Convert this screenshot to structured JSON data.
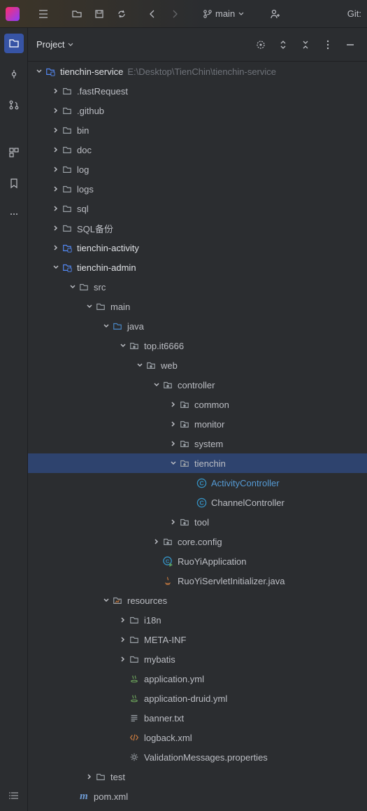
{
  "toolbar": {
    "branch": "main",
    "git_label": "Git:"
  },
  "panel": {
    "title": "Project"
  },
  "root": {
    "name": "tienchin-service",
    "path": "E:\\Desktop\\TienChin\\tienchin-service"
  },
  "tree": [
    {
      "d": 1,
      "a": "r",
      "i": "folder",
      "t": ".fastRequest"
    },
    {
      "d": 1,
      "a": "r",
      "i": "folder",
      "t": ".github"
    },
    {
      "d": 1,
      "a": "r",
      "i": "folder",
      "t": "bin"
    },
    {
      "d": 1,
      "a": "r",
      "i": "folder",
      "t": "doc"
    },
    {
      "d": 1,
      "a": "r",
      "i": "folder",
      "t": "log"
    },
    {
      "d": 1,
      "a": "r",
      "i": "folder",
      "t": "logs"
    },
    {
      "d": 1,
      "a": "r",
      "i": "folder",
      "t": "sql"
    },
    {
      "d": 1,
      "a": "r",
      "i": "folder",
      "t": "SQL备份"
    },
    {
      "d": 1,
      "a": "r",
      "i": "module",
      "t": "tienchin-activity",
      "hl": true
    },
    {
      "d": 1,
      "a": "d",
      "i": "module",
      "t": "tienchin-admin",
      "hl": true
    },
    {
      "d": 2,
      "a": "d",
      "i": "folder",
      "t": "src"
    },
    {
      "d": 3,
      "a": "d",
      "i": "folder",
      "t": "main"
    },
    {
      "d": 4,
      "a": "d",
      "i": "folder-blue",
      "t": "java"
    },
    {
      "d": 5,
      "a": "d",
      "i": "pkg",
      "t": "top.it6666"
    },
    {
      "d": 6,
      "a": "d",
      "i": "pkg",
      "t": "web"
    },
    {
      "d": 7,
      "a": "d",
      "i": "pkg",
      "t": "controller"
    },
    {
      "d": 8,
      "a": "r",
      "i": "pkg",
      "t": "common"
    },
    {
      "d": 8,
      "a": "r",
      "i": "pkg",
      "t": "monitor"
    },
    {
      "d": 8,
      "a": "r",
      "i": "pkg",
      "t": "system"
    },
    {
      "d": 8,
      "a": "d",
      "i": "pkg",
      "t": "tienchin",
      "sel": true
    },
    {
      "d": 9,
      "a": "",
      "i": "class",
      "t": "ActivityController",
      "link": true
    },
    {
      "d": 9,
      "a": "",
      "i": "class",
      "t": "ChannelController"
    },
    {
      "d": 8,
      "a": "r",
      "i": "pkg",
      "t": "tool"
    },
    {
      "d": 7,
      "a": "r",
      "i": "pkg",
      "t": "core.config"
    },
    {
      "d": 7,
      "a": "",
      "i": "class-run",
      "t": "RuoYiApplication"
    },
    {
      "d": 7,
      "a": "",
      "i": "java",
      "t": "RuoYiServletInitializer.java"
    },
    {
      "d": 4,
      "a": "d",
      "i": "res",
      "t": "resources"
    },
    {
      "d": 5,
      "a": "r",
      "i": "folder",
      "t": "i18n"
    },
    {
      "d": 5,
      "a": "r",
      "i": "folder",
      "t": "META-INF"
    },
    {
      "d": 5,
      "a": "r",
      "i": "folder",
      "t": "mybatis"
    },
    {
      "d": 5,
      "a": "",
      "i": "yml",
      "t": "application.yml"
    },
    {
      "d": 5,
      "a": "",
      "i": "yml",
      "t": "application-druid.yml"
    },
    {
      "d": 5,
      "a": "",
      "i": "txt",
      "t": "banner.txt"
    },
    {
      "d": 5,
      "a": "",
      "i": "xml",
      "t": "logback.xml"
    },
    {
      "d": 5,
      "a": "",
      "i": "prop",
      "t": "ValidationMessages.properties"
    },
    {
      "d": 3,
      "a": "r",
      "i": "folder",
      "t": "test"
    },
    {
      "d": 2,
      "a": "",
      "i": "maven",
      "t": "pom.xml"
    }
  ]
}
